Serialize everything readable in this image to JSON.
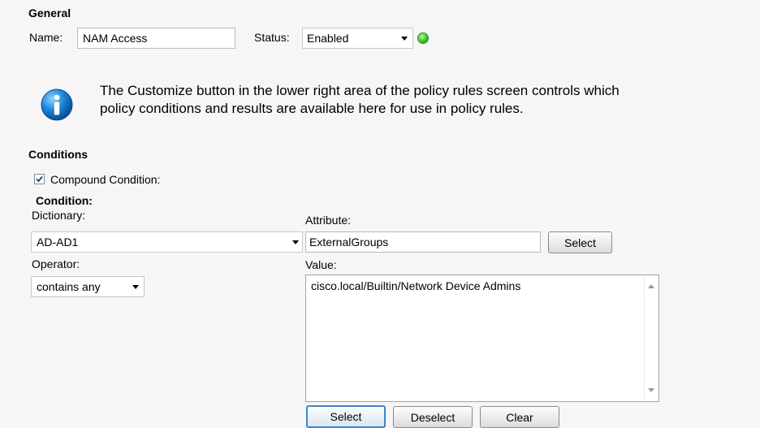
{
  "general": {
    "heading": "General",
    "name_label": "Name:",
    "name_value": "NAM Access",
    "status_label": "Status:",
    "status_value": "Enabled",
    "status_color": "#39c424"
  },
  "info": {
    "icon": "info-icon",
    "line1": "The Customize button in the lower right area of the policy rules screen controls which",
    "line2": "policy conditions and results are available here for use in policy rules."
  },
  "conditions": {
    "heading": "Conditions",
    "compound_checked": true,
    "compound_label": "Compound Condition:",
    "condition_heading": "Condition:",
    "dictionary_label": "Dictionary:",
    "dictionary_value": "AD-AD1",
    "attribute_label": "Attribute:",
    "attribute_value": "ExternalGroups",
    "attribute_select_button": "Select",
    "operator_label": "Operator:",
    "operator_value": "contains any",
    "value_label": "Value:",
    "value_items": [
      "cisco.local/Builtin/Network Device Admins"
    ],
    "buttons": {
      "select": "Select",
      "deselect": "Deselect",
      "clear": "Clear"
    }
  }
}
